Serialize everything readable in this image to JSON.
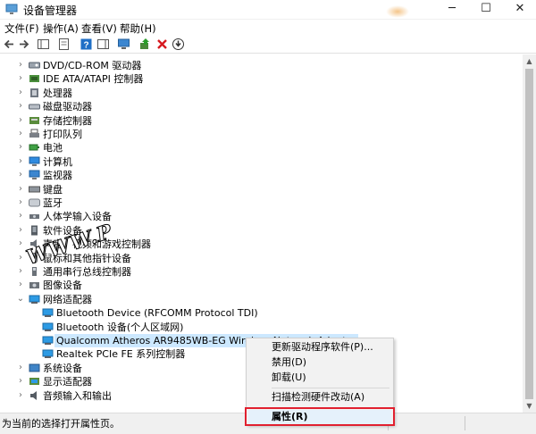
{
  "window": {
    "title": "设备管理器",
    "controls": {
      "minimize": "─",
      "maximize": "☐",
      "close": "✕"
    }
  },
  "menu": {
    "items": [
      "文件(F)",
      "操作(A)",
      "查看(V)",
      "帮助(H)"
    ]
  },
  "tree": {
    "categories_top": [
      {
        "label": "DVD/CD-ROM 驱动器",
        "icon": "dvd-drive-icon"
      },
      {
        "label": "IDE ATA/ATAPI 控制器",
        "icon": "ide-controller-icon"
      },
      {
        "label": "处理器",
        "icon": "processor-icon"
      },
      {
        "label": "磁盘驱动器",
        "icon": "disk-drive-icon"
      },
      {
        "label": "存储控制器",
        "icon": "storage-controller-icon"
      },
      {
        "label": "打印队列",
        "icon": "printer-icon"
      },
      {
        "label": "电池",
        "icon": "battery-icon"
      },
      {
        "label": "计算机",
        "icon": "computer-icon"
      },
      {
        "label": "监视器",
        "icon": "monitor-icon"
      },
      {
        "label": "键盘",
        "icon": "keyboard-icon"
      },
      {
        "label": "蓝牙",
        "icon": "bluetooth-icon"
      },
      {
        "label": "人体学输入设备",
        "icon": "hid-icon"
      },
      {
        "label": "软件设备",
        "icon": "software-device-icon"
      },
      {
        "label": "声音、视频和游戏控制器",
        "icon": "sound-icon"
      },
      {
        "label": "鼠标和其他指针设备",
        "icon": "mouse-icon"
      },
      {
        "label": "通用串行总线控制器",
        "icon": "usb-icon"
      },
      {
        "label": "图像设备",
        "icon": "camera-icon"
      }
    ],
    "network_category": {
      "label": "网络适配器",
      "icon": "network-adapter-icon"
    },
    "network_children": [
      {
        "label": "Bluetooth Device (RFCOMM Protocol TDI)",
        "icon": "network-adapter-icon"
      },
      {
        "label": "Bluetooth 设备(个人区域网)",
        "icon": "network-adapter-icon"
      },
      {
        "label": "Qualcomm Atheros AR9485WB-EG Wireless Network Adapter",
        "icon": "network-adapter-icon",
        "selected": true
      },
      {
        "label": "Realtek PCIe FE 系列控制器",
        "icon": "network-adapter-icon"
      }
    ],
    "categories_bottom": [
      {
        "label": "系统设备",
        "icon": "system-device-icon"
      },
      {
        "label": "显示适配器",
        "icon": "display-adapter-icon"
      },
      {
        "label": "音频输入和输出",
        "icon": "audio-io-icon"
      }
    ]
  },
  "watermark": "WWW.P",
  "context_menu": {
    "items": [
      {
        "label": "更新驱动程序软件(P)...",
        "group": 0
      },
      {
        "label": "禁用(D)",
        "group": 0
      },
      {
        "label": "卸载(U)",
        "group": 0
      },
      {
        "label": "扫描检测硬件改动(A)",
        "group": 1
      },
      {
        "label": "属性(R)",
        "group": 2,
        "bold": true,
        "highlighted": true
      }
    ]
  },
  "status": {
    "text": "为当前的选择打开属性页。"
  },
  "colors": {
    "selection": "#cce8ff",
    "highlight_box": "#e1202f",
    "accent": "#2b8fd8"
  }
}
